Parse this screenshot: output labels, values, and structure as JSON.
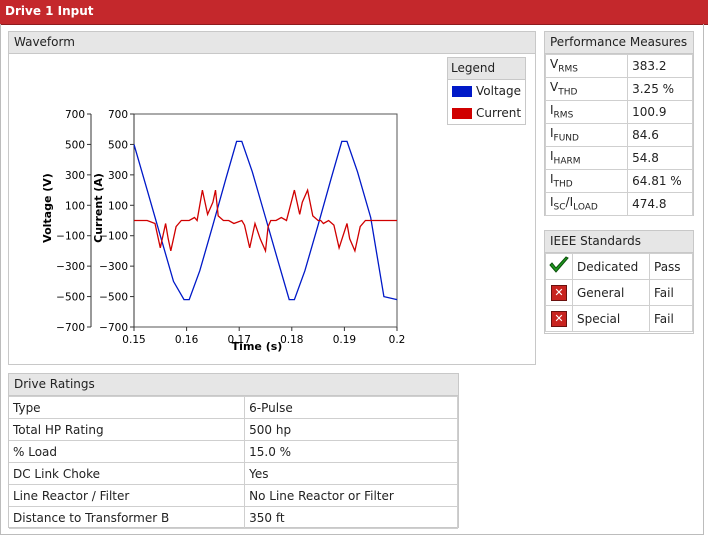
{
  "window_title": "Drive 1 Input",
  "waveform": {
    "title": "Waveform",
    "legend_title": "Legend",
    "colors": {
      "voltage": "#0019c8",
      "current": "#d00000"
    }
  },
  "chart_data": {
    "type": "line",
    "xlabel": "Time (s)",
    "ylabel": "Voltage (V)",
    "ylabel2": "Current (A)",
    "xlim": [
      0.15,
      0.2
    ],
    "ylim": [
      -700,
      700
    ],
    "xticks": [
      "0.15",
      "0.16",
      "0.17",
      "0.18",
      "0.19",
      "0.2"
    ],
    "yticks": [
      "700",
      "500",
      "300",
      "100",
      "−100",
      "−300",
      "−500",
      "−700"
    ],
    "grid": true,
    "legend_position": "top-right",
    "series": [
      {
        "name": "Voltage",
        "color": "#0019c8",
        "x": [
          0.15,
          0.1525,
          0.155,
          0.1575,
          0.1595,
          0.1605,
          0.1625,
          0.165,
          0.1675,
          0.1695,
          0.1705,
          0.1725,
          0.175,
          0.1775,
          0.1795,
          0.1805,
          0.1825,
          0.185,
          0.1875,
          0.1895,
          0.1905,
          0.1925,
          0.195,
          0.1975,
          0.2
        ],
        "y": [
          500,
          200,
          -100,
          -400,
          -520,
          -520,
          -330,
          -30,
          280,
          520,
          520,
          320,
          20,
          -280,
          -520,
          -520,
          -330,
          -30,
          280,
          520,
          520,
          320,
          20,
          -500,
          -520
        ]
      },
      {
        "name": "Current",
        "color": "#d00000",
        "x": [
          0.15,
          0.1525,
          0.154,
          0.155,
          0.156,
          0.1565,
          0.157,
          0.158,
          0.159,
          0.1605,
          0.1615,
          0.162,
          0.163,
          0.164,
          0.165,
          0.1655,
          0.166,
          0.167,
          0.168,
          0.169,
          0.1705,
          0.171,
          0.172,
          0.173,
          0.174,
          0.175,
          0.1755,
          0.176,
          0.177,
          0.178,
          0.179,
          0.1805,
          0.1815,
          0.182,
          0.183,
          0.184,
          0.185,
          0.1855,
          0.186,
          0.187,
          0.188,
          0.189,
          0.1905,
          0.191,
          0.192,
          0.193,
          0.194,
          0.195,
          0.1955,
          0.2
        ],
        "y": [
          0,
          0,
          -20,
          -180,
          -20,
          -120,
          -200,
          -40,
          0,
          0,
          20,
          0,
          200,
          40,
          120,
          200,
          30,
          0,
          0,
          -20,
          0,
          -30,
          -180,
          -20,
          -120,
          -200,
          -40,
          0,
          0,
          20,
          0,
          200,
          40,
          120,
          200,
          30,
          0,
          0,
          -20,
          0,
          -30,
          -180,
          -20,
          -120,
          -200,
          -40,
          0,
          0,
          0,
          0
        ]
      }
    ]
  },
  "performance": {
    "title": "Performance Measures",
    "rows": [
      {
        "main": "V",
        "sub": "RMS",
        "value": "383.2"
      },
      {
        "main": "V",
        "sub": "THD",
        "value": "3.25 %"
      },
      {
        "main": "I",
        "sub": "RMS",
        "value": "100.9"
      },
      {
        "main": "I",
        "sub": "FUND",
        "value": "84.6"
      },
      {
        "main": "I",
        "sub": "HARM",
        "value": "54.8"
      },
      {
        "main": "I",
        "sub": "THD",
        "value": "64.81 %"
      },
      {
        "main": "I",
        "sub": "SC",
        "main2": "/I",
        "sub2": "LOAD",
        "value": "474.8"
      }
    ]
  },
  "ieee": {
    "title": "IEEE Standards",
    "rows": [
      {
        "icon": "check-icon",
        "name": "Dedicated",
        "result": "Pass"
      },
      {
        "icon": "x-icon",
        "name": "General",
        "result": "Fail"
      },
      {
        "icon": "x-icon",
        "name": "Special",
        "result": "Fail"
      }
    ]
  },
  "ratings": {
    "title": "Drive Ratings",
    "rows": [
      {
        "label": "Type",
        "value": "6-Pulse"
      },
      {
        "label": "Total HP Rating",
        "value": "500 hp"
      },
      {
        "label": "% Load",
        "value": "15.0 %"
      },
      {
        "label": "DC Link Choke",
        "value": "Yes"
      },
      {
        "label": "Line Reactor / Filter",
        "value": "No Line Reactor or Filter"
      },
      {
        "label": "Distance to Transformer B",
        "value": "350 ft"
      }
    ]
  }
}
